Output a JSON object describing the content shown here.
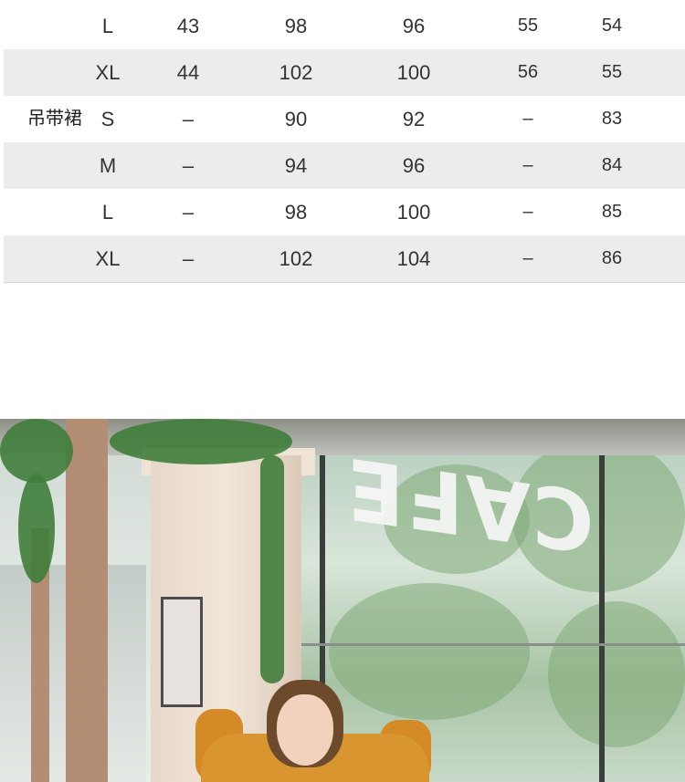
{
  "size_table": {
    "rows": [
      {
        "group": "",
        "size": "L",
        "values": [
          "43",
          "98",
          "96",
          "55",
          "54"
        ],
        "shaded": false
      },
      {
        "group": "",
        "size": "XL",
        "values": [
          "44",
          "102",
          "100",
          "56",
          "55"
        ],
        "shaded": true
      },
      {
        "group": "吊带裙",
        "size": "S",
        "values": [
          "–",
          "90",
          "92",
          "–",
          "83"
        ],
        "shaded": false
      },
      {
        "group": "",
        "size": "M",
        "values": [
          "–",
          "94",
          "96",
          "–",
          "84"
        ],
        "shaded": true
      },
      {
        "group": "",
        "size": "L",
        "values": [
          "–",
          "98",
          "100",
          "–",
          "85"
        ],
        "shaded": false
      },
      {
        "group": "",
        "size": "XL",
        "values": [
          "–",
          "102",
          "104",
          "–",
          "86"
        ],
        "shaded": true
      }
    ]
  },
  "photo": {
    "sign_text": "CAFE"
  },
  "colors": {
    "shaded_row": "#ececec",
    "text": "#333333"
  }
}
